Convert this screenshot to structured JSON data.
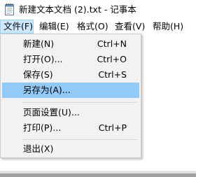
{
  "window": {
    "title": "新建文本文档 (2).txt - 记事本",
    "icon": "notepad-icon"
  },
  "menubar": {
    "items": [
      {
        "label": "文件(F)",
        "key": "F",
        "active": true
      },
      {
        "label": "编辑(E)",
        "key": "E",
        "active": false
      },
      {
        "label": "格式(O)",
        "key": "O",
        "active": false
      },
      {
        "label": "查看(V)",
        "key": "V",
        "active": false
      },
      {
        "label": "帮助(H)",
        "key": "H",
        "active": false
      }
    ]
  },
  "file_menu": {
    "items": [
      {
        "label": "新建(N)",
        "shortcut": "Ctrl+N",
        "highlighted": false
      },
      {
        "label": "打开(O)...",
        "shortcut": "Ctrl+O",
        "highlighted": false
      },
      {
        "label": "保存(S)",
        "shortcut": "Ctrl+S",
        "highlighted": false
      },
      {
        "label": "另存为(A)...",
        "shortcut": "",
        "highlighted": true
      },
      {
        "label": "页面设置(U)...",
        "shortcut": "",
        "highlighted": false
      },
      {
        "label": "打印(P)...",
        "shortcut": "Ctrl+P",
        "highlighted": false
      },
      {
        "label": "退出(X)",
        "shortcut": "",
        "highlighted": false
      }
    ]
  },
  "colors": {
    "highlight": "#91c9f7",
    "menu_background": "#f2f2f2",
    "active_menu": "#cce8ff"
  }
}
